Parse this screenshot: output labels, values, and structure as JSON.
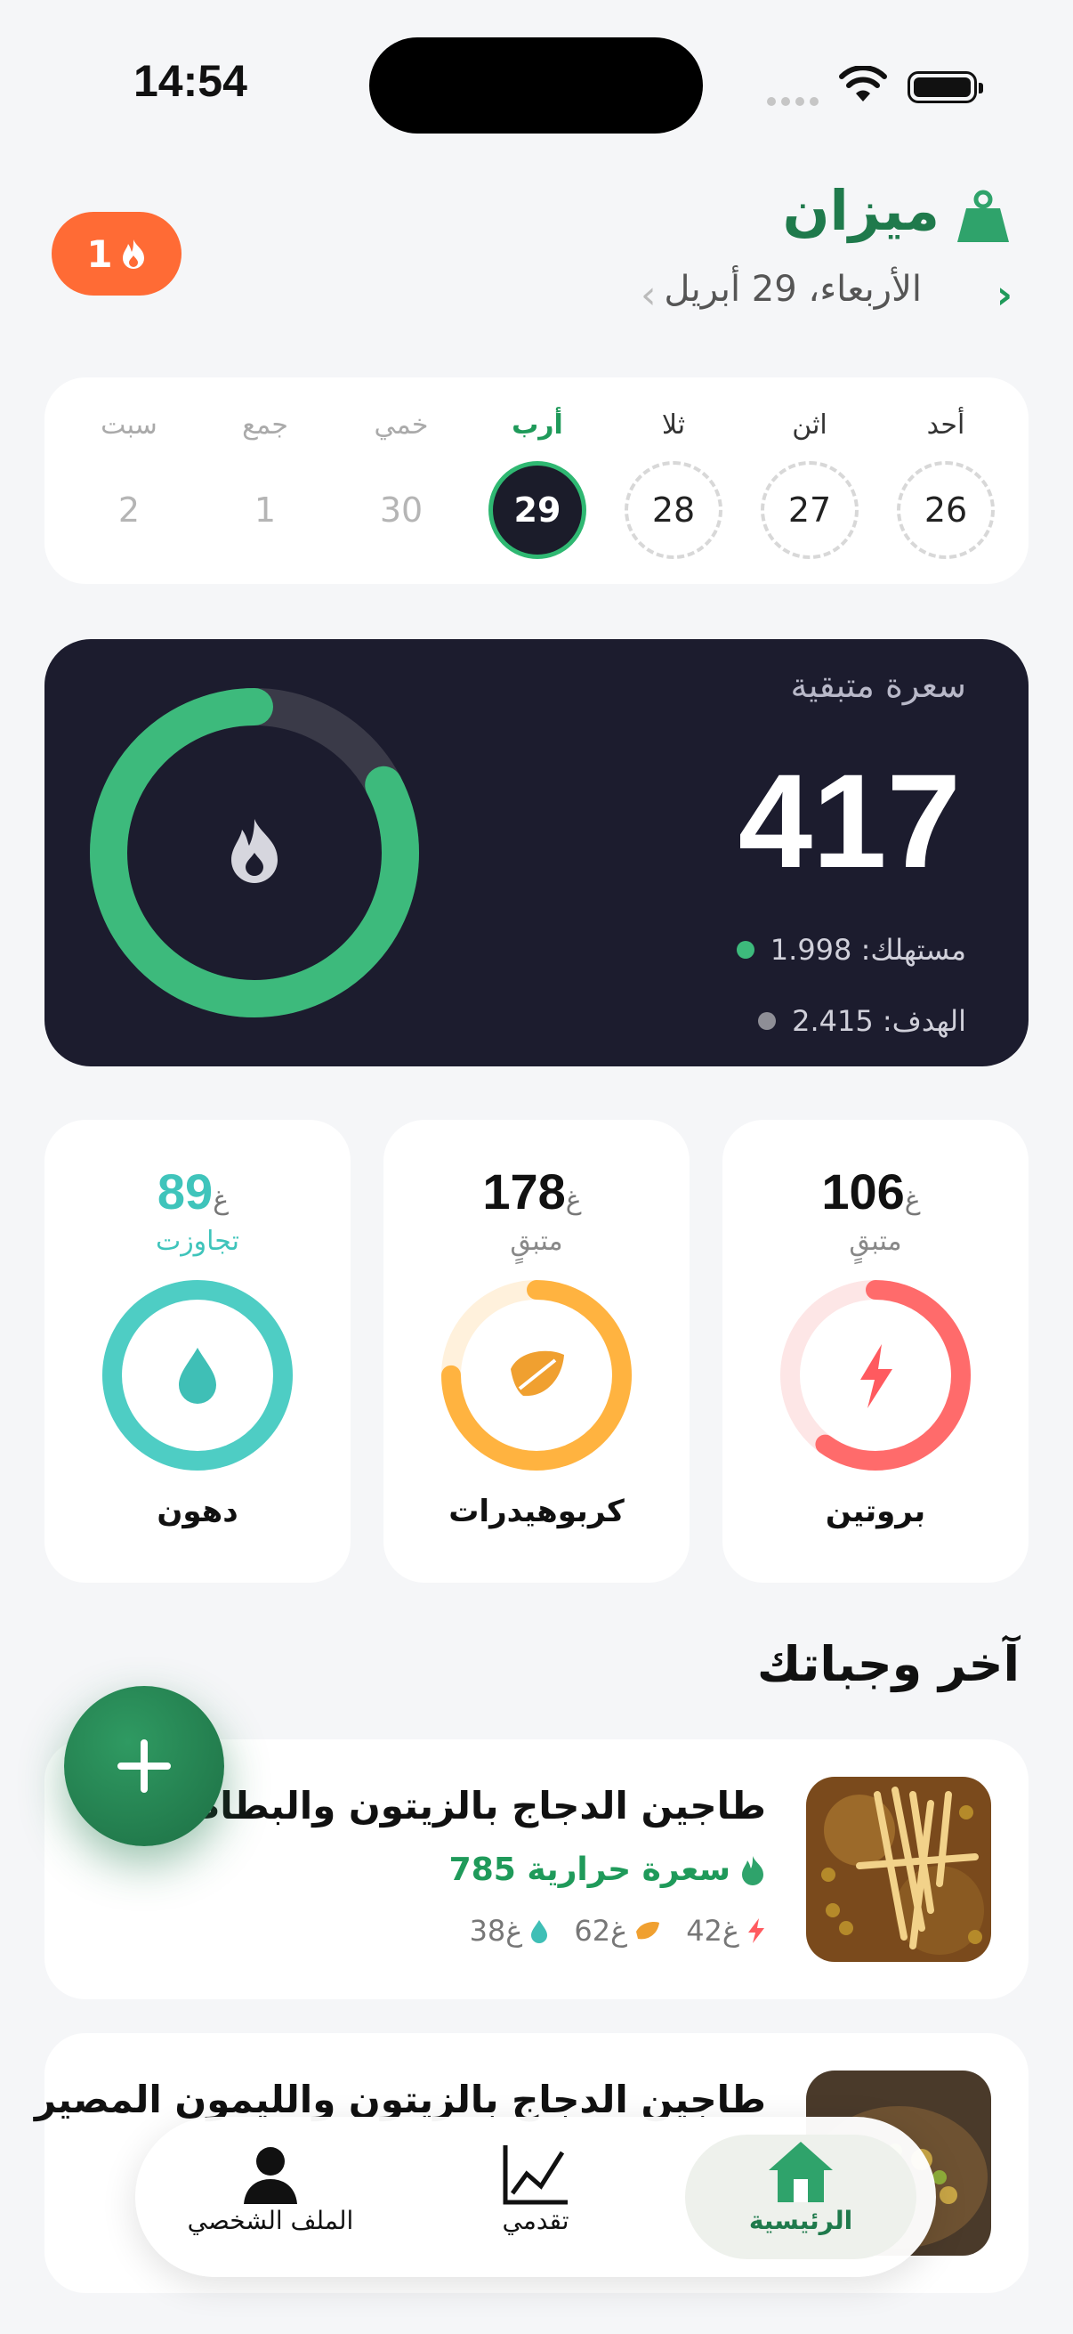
{
  "status": {
    "time": "14:54"
  },
  "header": {
    "app_name": "ميزان",
    "date": "الأربعاء، 29 أبريل",
    "streak_count": "1"
  },
  "week": {
    "days": [
      {
        "label": "أحد",
        "num": "26",
        "state": "past"
      },
      {
        "label": "اثن",
        "num": "27",
        "state": "past"
      },
      {
        "label": "ثلا",
        "num": "28",
        "state": "past"
      },
      {
        "label": "أرب",
        "num": "29",
        "state": "selected"
      },
      {
        "label": "خمي",
        "num": "30",
        "state": "future"
      },
      {
        "label": "جمع",
        "num": "1",
        "state": "future"
      },
      {
        "label": "سبت",
        "num": "2",
        "state": "future"
      }
    ]
  },
  "calories": {
    "label": "سعرة متبقية",
    "remaining": "417",
    "consumed_text": "مستهلك: 1.998",
    "goal_text": "الهدف: 2.415",
    "consumed_fraction": 0.827,
    "colors": {
      "ring": "#3dba7c",
      "track": "#3a3a48"
    }
  },
  "macros": [
    {
      "key": "protein",
      "value": "106",
      "unit": "غ",
      "status": "متبقٍ",
      "name": "بروتين",
      "fraction": 0.6,
      "color": "#ff6b6b",
      "track": "#fde6e6"
    },
    {
      "key": "carbs",
      "value": "178",
      "unit": "غ",
      "status": "متبقٍ",
      "name": "كربوهيدرات",
      "fraction": 0.75,
      "color": "#ffb340",
      "track": "#fff1dc"
    },
    {
      "key": "fat",
      "value": "89",
      "unit": "غ",
      "status": "تجاوزت",
      "name": "دهون",
      "fraction": 1.0,
      "color": "#4ecdc4",
      "track": "#dff7f5"
    }
  ],
  "meals_section": {
    "title": "آخر وجباتك"
  },
  "meals": [
    {
      "name": "طاجين الدجاج بالزيتون والبطاطس",
      "kcal": "785 سعرة حرارية",
      "protein": "42غ",
      "carbs": "62غ",
      "fat": "38غ"
    },
    {
      "name": "طاجين الدجاج بالزيتون والليمون المصير"
    }
  ],
  "nav": {
    "profile": "الملف الشخصي",
    "progress": "تقدمي",
    "home": "الرئيسية"
  }
}
